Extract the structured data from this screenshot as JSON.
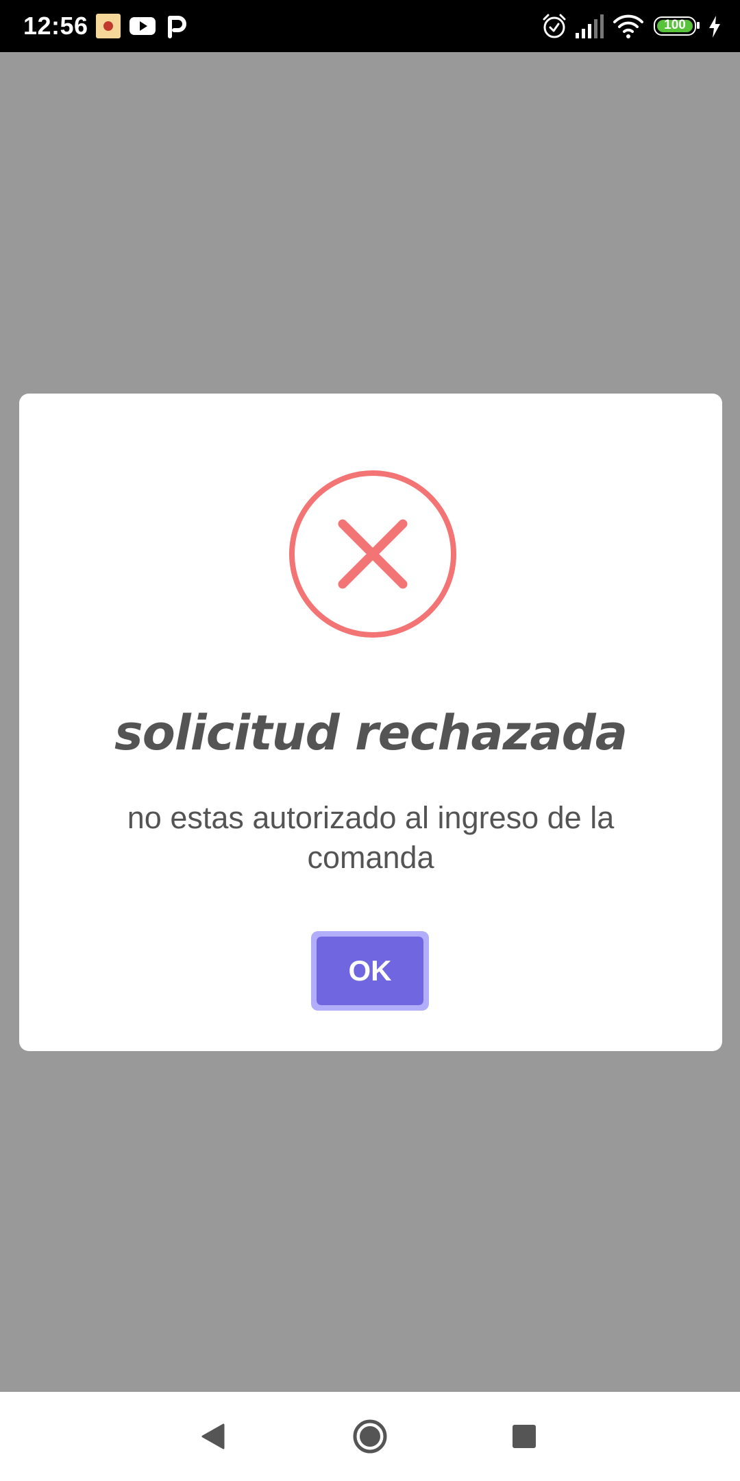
{
  "status_bar": {
    "time": "12:56",
    "notification_icons": [
      "app-notification-icon",
      "youtube-icon",
      "p-app-icon"
    ],
    "system_icons": [
      "alarm-icon",
      "signal-icon",
      "wifi-icon",
      "battery-icon",
      "charging-icon"
    ],
    "battery_level": "100",
    "battery_fraction": 1.0
  },
  "dialog": {
    "icon": "error-x-icon",
    "title": "solicitud rechazada",
    "message": "no estas autorizado al ingreso de la comanda",
    "ok_label": "OK"
  },
  "nav_bar": {
    "buttons": [
      "back-icon",
      "home-icon",
      "recents-icon"
    ]
  },
  "colors": {
    "backdrop": "#999999",
    "error": "#f27474",
    "confirm": "#7066e0",
    "confirm_focus": "#b3aefa",
    "text": "#545454"
  }
}
